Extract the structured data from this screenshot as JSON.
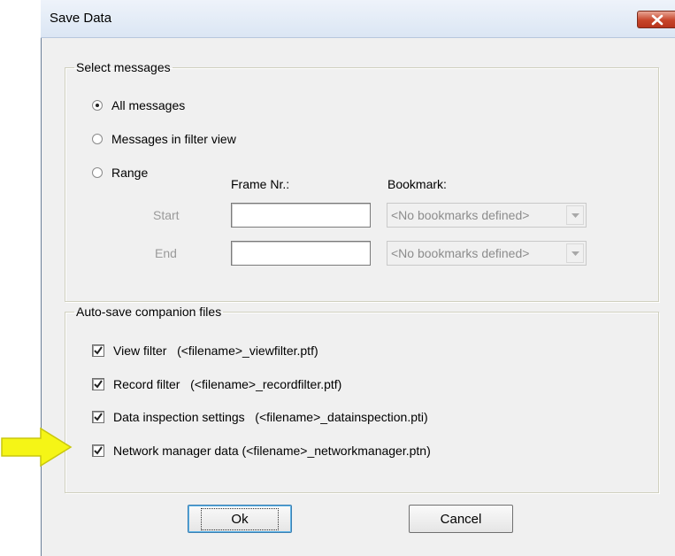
{
  "window": {
    "title": "Save Data"
  },
  "select_messages": {
    "legend": "Select messages",
    "options": [
      {
        "label": "All messages",
        "selected": true
      },
      {
        "label": "Messages in filter view",
        "selected": false
      },
      {
        "label": "Range",
        "selected": false
      }
    ],
    "frame_nr_label": "Frame Nr.:",
    "bookmark_label": "Bookmark:",
    "start_label": "Start",
    "end_label": "End",
    "start_frame_value": "",
    "end_frame_value": "",
    "start_bookmark": "<No bookmarks defined>",
    "end_bookmark": "<No bookmarks defined>"
  },
  "companion_files": {
    "legend": "Auto-save companion files",
    "items": [
      {
        "label": "View filter   (<filename>_viewfilter.ptf)",
        "checked": true
      },
      {
        "label": "Record filter   (<filename>_recordfilter.ptf)",
        "checked": true
      },
      {
        "label": "Data inspection settings   (<filename>_datainspection.pti)",
        "checked": true
      },
      {
        "label": "Network manager data (<filename>_networkmanager.ptn)",
        "checked": true
      }
    ]
  },
  "buttons": {
    "ok": "Ok",
    "cancel": "Cancel"
  },
  "colors": {
    "highlight_arrow": "#f5f516",
    "close_button": "#c7452a"
  },
  "icons": {
    "close": "close-icon",
    "pointer": "arrow-right-icon"
  }
}
